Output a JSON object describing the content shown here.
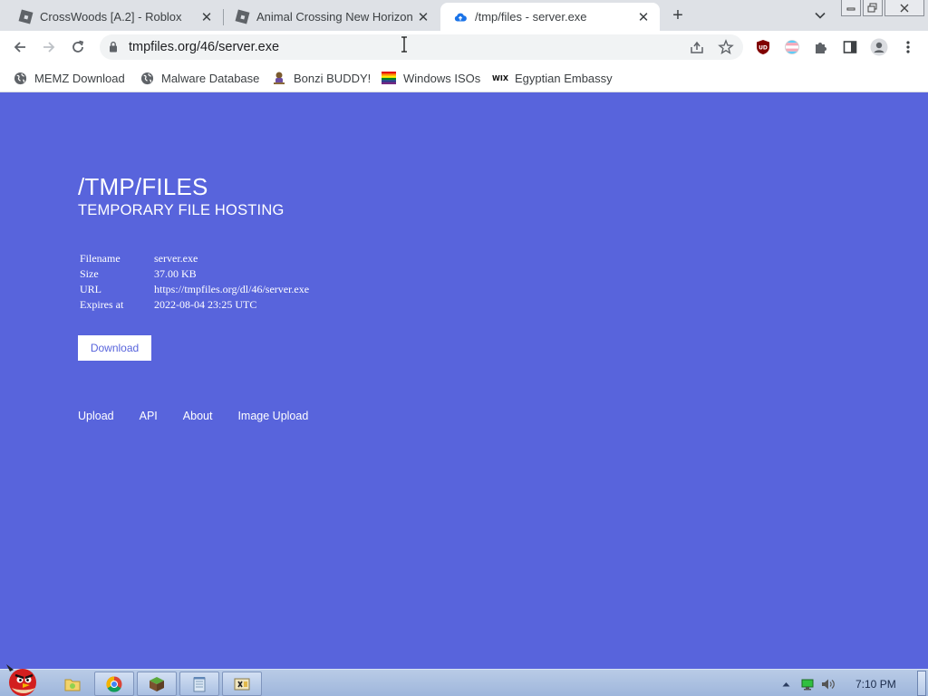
{
  "browser": {
    "tabs": [
      {
        "title": "CrossWoods [A.2] - Roblox",
        "icon": "roblox-icon"
      },
      {
        "title": "Animal Crossing New Horizon",
        "icon": "roblox-icon"
      },
      {
        "title": "/tmp/files - server.exe",
        "icon": "cloud-upload-icon",
        "active": true
      }
    ],
    "address": "tmpfiles.org/46/server.exe",
    "bookmarks": [
      {
        "label": "MEMZ Download",
        "icon": "globe-icon"
      },
      {
        "label": "Malware Database",
        "icon": "globe-icon"
      },
      {
        "label": "Bonzi BUDDY!",
        "icon": "bonzi-icon"
      },
      {
        "label": "Windows ISOs",
        "icon": "rainbow-flag-icon"
      },
      {
        "label": "Egyptian Embassy",
        "icon": "wix-icon"
      }
    ],
    "wix_mark": "WIX"
  },
  "page": {
    "title": "/TMP/FILES",
    "subtitle": "TEMPORARY FILE HOSTING",
    "file_info": [
      {
        "key": "Filename",
        "value": "server.exe"
      },
      {
        "key": "Size",
        "value": "37.00 KB"
      },
      {
        "key": "URL",
        "value": "https://tmpfiles.org/dl/46/server.exe"
      },
      {
        "key": "Expires at",
        "value": "2022-08-04 23:25 UTC"
      }
    ],
    "download_label": "Download",
    "footer_links": [
      "Upload",
      "API",
      "About",
      "Image Upload"
    ],
    "background_color": "#5864dc"
  },
  "taskbar": {
    "clock": "7:10 PM"
  }
}
